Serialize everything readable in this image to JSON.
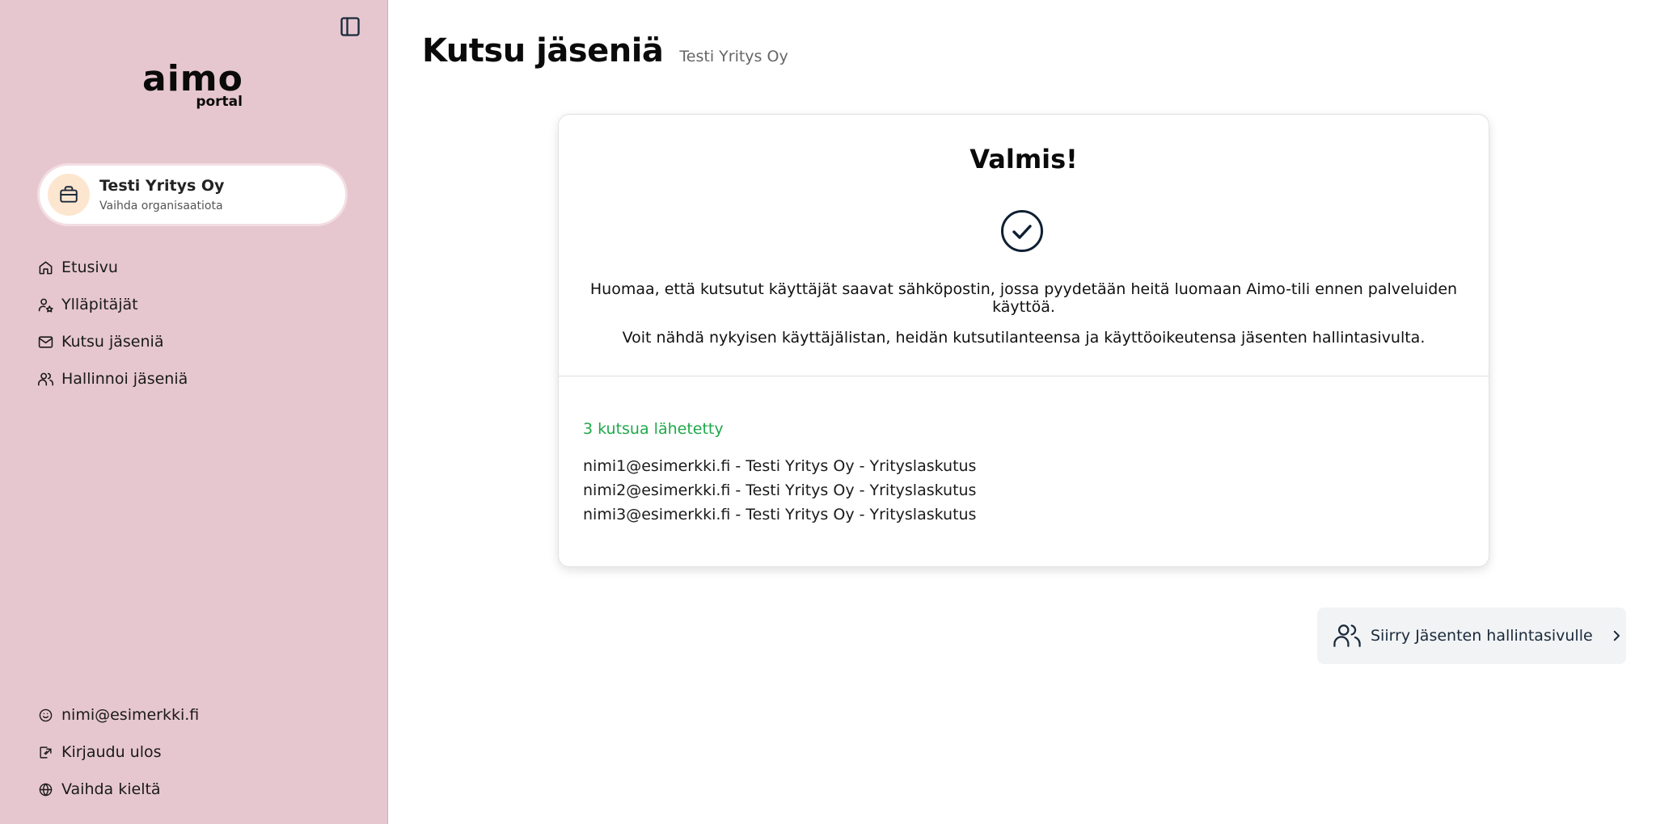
{
  "sidebar": {
    "logo_main": "aimo",
    "logo_sub": "portal",
    "org": {
      "name": "Testi Yritys Oy",
      "switch_label": "Vaihda organisaatiota"
    },
    "items": [
      {
        "label": "Etusivu",
        "icon": "home-icon"
      },
      {
        "label": "Ylläpitäjät",
        "icon": "admin-user-icon"
      },
      {
        "label": "Kutsu jäseniä",
        "icon": "mail-icon"
      },
      {
        "label": "Hallinnoi jäseniä",
        "icon": "users-icon"
      }
    ],
    "bottom_items": [
      {
        "label": "nimi@esimerkki.fi",
        "icon": "smiley-icon"
      },
      {
        "label": "Kirjaudu ulos",
        "icon": "logout-icon"
      },
      {
        "label": "Vaihda kieltä",
        "icon": "globe-icon"
      }
    ]
  },
  "header": {
    "title": "Kutsu jäseniä",
    "subtitle": "Testi Yritys Oy"
  },
  "card": {
    "title": "Valmis!",
    "note1": "Huomaa, että kutsutut käyttäjät saavat sähköpostin, jossa pyydetään heitä luomaan Aimo-tili ennen palveluiden käyttöä.",
    "note2": "Voit nähdä nykyisen käyttäjälistan, heidän kutsutilanteensa ja käyttöoikeutensa jäsenten hallintasivulta.",
    "sent_count": "3 kutsua lähetetty",
    "invites": [
      "nimi1@esimerkki.fi - Testi Yritys Oy - Yrityslaskutus",
      "nimi2@esimerkki.fi - Testi Yritys Oy - Yrityslaskutus",
      "nimi3@esimerkki.fi - Testi Yritys Oy - Yrityslaskutus"
    ]
  },
  "go_button": {
    "label": "Siirry Jäsenten hallintasivulle",
    "icon": "users-icon"
  },
  "colors": {
    "sidebar_bg": "#e6c7d0",
    "success_green": "#1fa84a",
    "org_icon_bg": "#fde6cf",
    "button_bg": "#f1f3f5"
  }
}
